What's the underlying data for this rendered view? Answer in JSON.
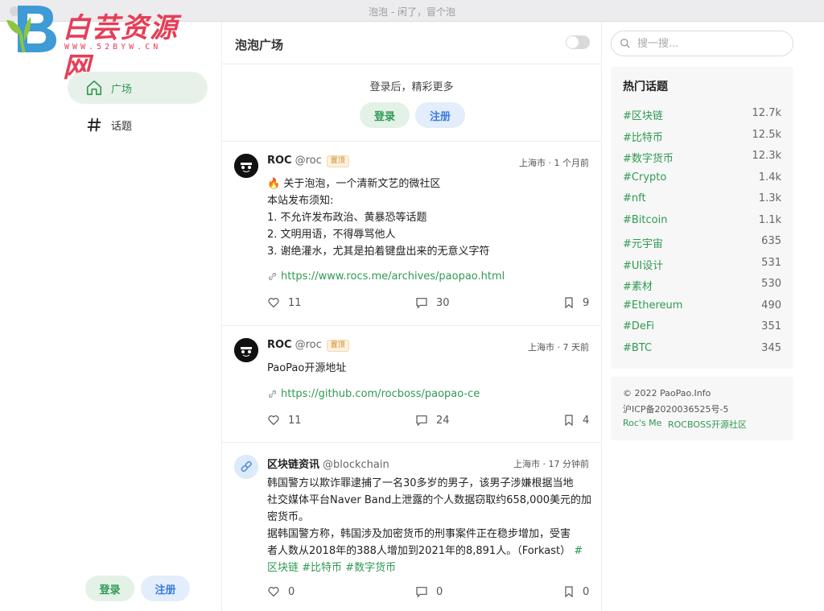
{
  "window": {
    "title": "泡泡 - 闲了，冒个泡"
  },
  "logo": {
    "text": "白芸资源网",
    "sub": "WWW.52BYW.CN"
  },
  "nav": {
    "items": [
      {
        "label": "广场",
        "icon": "home-icon",
        "active": true
      },
      {
        "label": "话题",
        "icon": "hash-icon",
        "active": false
      }
    ],
    "login_label": "登录",
    "register_label": "注册"
  },
  "main": {
    "title": "泡泡广场",
    "login_prompt": {
      "message": "登录后，精彩更多",
      "login_label": "登录",
      "register_label": "注册"
    },
    "posts": [
      {
        "author": "ROC",
        "handle": "@roc",
        "pinned_label": "置顶",
        "location_time": "上海市 · 1 个月前",
        "lines": [
          "🔥 关于泡泡，一个清新文艺的微社区",
          "本站发布须知:",
          "1. 不允许发布政治、黄暴恐等话题",
          "2. 文明用语，不得辱骂他人",
          "3. 谢绝灌水，尤其是拍着键盘出来的无意义字符"
        ],
        "link": "https://www.rocs.me/archives/paopao.html",
        "likes": "11",
        "comments": "30",
        "collections": "9"
      },
      {
        "author": "ROC",
        "handle": "@roc",
        "pinned_label": "置顶",
        "location_time": "上海市 · 7 天前",
        "lines": [
          "PaoPao开源地址"
        ],
        "link": "https://github.com/rocboss/paopao-ce",
        "likes": "11",
        "comments": "24",
        "collections": "4"
      },
      {
        "author": "区块链资讯",
        "handle": "@blockchain",
        "location_time": "上海市 · 17 分钟前",
        "lines": [
          "韩国警方以欺诈罪逮捕了一名30多岁的男子，该男子涉嫌根据当地",
          "社交媒体平台Naver Band上泄露的个人数据窃取约658,000美元的加",
          "密货币。",
          "据韩国警方称，韩国涉及加密货币的刑事案件正在稳步增加，受害",
          "者人数从2018年的388人增加到2021年的8,891人。（Forkast）"
        ],
        "tags": [
          "#",
          "区块链",
          "#比特币",
          "#数字货币"
        ],
        "likes": "0",
        "comments": "0",
        "collections": "0"
      }
    ]
  },
  "search": {
    "placeholder": "搜一搜..."
  },
  "hot_topics": {
    "title": "热门话题",
    "items": [
      {
        "name": "#区块链",
        "count": "12.7k"
      },
      {
        "name": "#比特币",
        "count": "12.5k"
      },
      {
        "name": "#数字货币",
        "count": "12.3k"
      },
      {
        "name": "#Crypto",
        "count": "1.4k"
      },
      {
        "name": "#nft",
        "count": "1.3k"
      },
      {
        "name": "#Bitcoin",
        "count": "1.1k"
      },
      {
        "name": "#元宇宙",
        "count": "635"
      },
      {
        "name": "#UI设计",
        "count": "531"
      },
      {
        "name": "#素材",
        "count": "530"
      },
      {
        "name": "#Ethereum",
        "count": "490"
      },
      {
        "name": "#DeFi",
        "count": "351"
      },
      {
        "name": "#BTC",
        "count": "345"
      }
    ]
  },
  "footer": {
    "copyright": "© 2022 PaoPao.Info",
    "icp": "沪ICP备2020036525号-5",
    "links": [
      "Roc's Me",
      "ROCBOSS开源社区"
    ]
  },
  "colors": {
    "accent": "#2f9a52",
    "blue": "#3a7ce0",
    "logo_red": "#e63e57"
  }
}
